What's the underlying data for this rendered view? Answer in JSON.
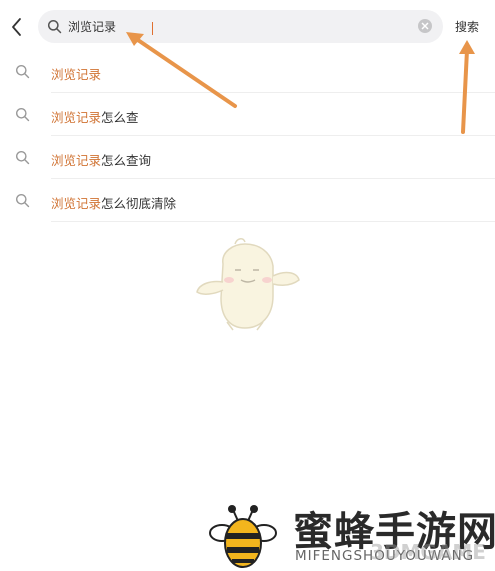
{
  "search": {
    "value": "浏览记录",
    "action_label": "搜索"
  },
  "suggestions": [
    {
      "highlight": "浏览记录",
      "rest": ""
    },
    {
      "highlight": "浏览记录",
      "rest": "怎么查"
    },
    {
      "highlight": "浏览记录",
      "rest": "怎么查询"
    },
    {
      "highlight": "浏览记录",
      "rest": "怎么彻底清除"
    }
  ],
  "watermark": {
    "title": "蜜蜂手游网",
    "subtitle": "MIFENGSHOUYOUWANG",
    "overlay": "3DMGAME"
  },
  "colors": {
    "highlight": "#d07333",
    "annotation_arrow": "#e8954a",
    "search_box_bg": "#f1f1f3"
  },
  "icons": {
    "back": "chevron-left-icon",
    "search": "search-icon",
    "clear": "clear-icon"
  }
}
